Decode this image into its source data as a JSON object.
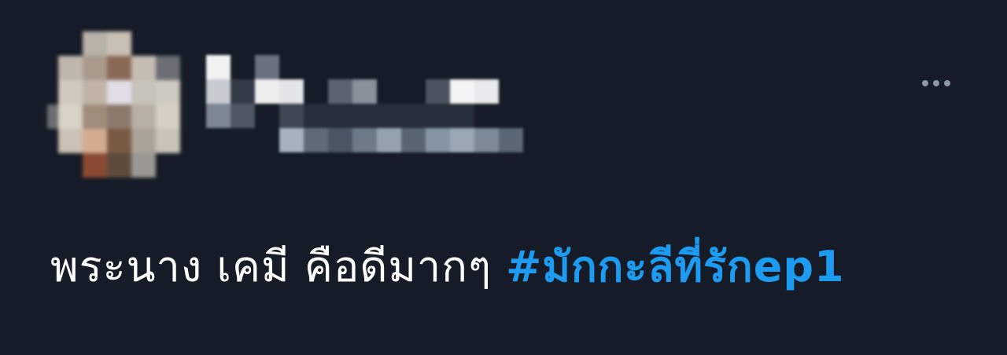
{
  "tweet": {
    "text": "พระนาง เคมี คือดีมากๆ",
    "hashtag": "#มักกะลีที่รักep1",
    "more_icon": "more-horizontal-icon"
  },
  "colors": {
    "background": "#151c27",
    "text": "#ffffff",
    "hashtag": "#1d9bf0",
    "icon": "#8b98a5"
  }
}
